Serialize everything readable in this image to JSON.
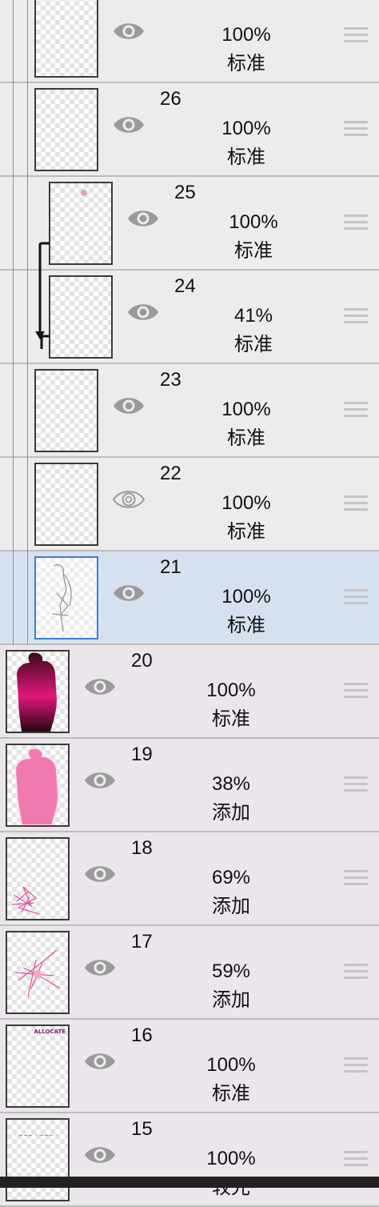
{
  "layers": [
    {
      "number": "",
      "opacity": "100%",
      "blend_mode": "标准",
      "eye": "visible-eye-icon"
    },
    {
      "number": "26",
      "opacity": "100%",
      "blend_mode": "标准",
      "eye": "visible-eye-icon"
    },
    {
      "number": "25",
      "opacity": "100%",
      "blend_mode": "标准",
      "eye": "visible-eye-icon"
    },
    {
      "number": "24",
      "opacity": "41%",
      "blend_mode": "标准",
      "eye": "visible-eye-icon"
    },
    {
      "number": "23",
      "opacity": "100%",
      "blend_mode": "标准",
      "eye": "visible-eye-icon"
    },
    {
      "number": "22",
      "opacity": "100%",
      "blend_mode": "标准",
      "eye": "hidden-eye-outline-icon"
    },
    {
      "number": "21",
      "opacity": "100%",
      "blend_mode": "标准",
      "eye": "visible-eye-icon",
      "selected": true
    },
    {
      "number": "20",
      "opacity": "100%",
      "blend_mode": "标准",
      "eye": "visible-eye-icon"
    },
    {
      "number": "19",
      "opacity": "38%",
      "blend_mode": "添加",
      "eye": "visible-eye-icon"
    },
    {
      "number": "18",
      "opacity": "69%",
      "blend_mode": "添加",
      "eye": "visible-eye-icon"
    },
    {
      "number": "17",
      "opacity": "59%",
      "blend_mode": "添加",
      "eye": "visible-eye-icon"
    },
    {
      "number": "16",
      "opacity": "100%",
      "blend_mode": "标准",
      "eye": "visible-eye-icon",
      "thumb_text": "ALLOCATE"
    },
    {
      "number": "15",
      "opacity": "100%",
      "blend_mode": "较光",
      "eye": "visible-eye-icon"
    }
  ],
  "colors": {
    "row_bg": "#ececec",
    "folder_row_bg": "#ebe5ec",
    "selected_row_bg": "#d5e1ef",
    "selected_border": "#3a7fd6",
    "eye": "#9a9a9a",
    "pink": "#f07ab0",
    "magenta": "#c0185f"
  }
}
